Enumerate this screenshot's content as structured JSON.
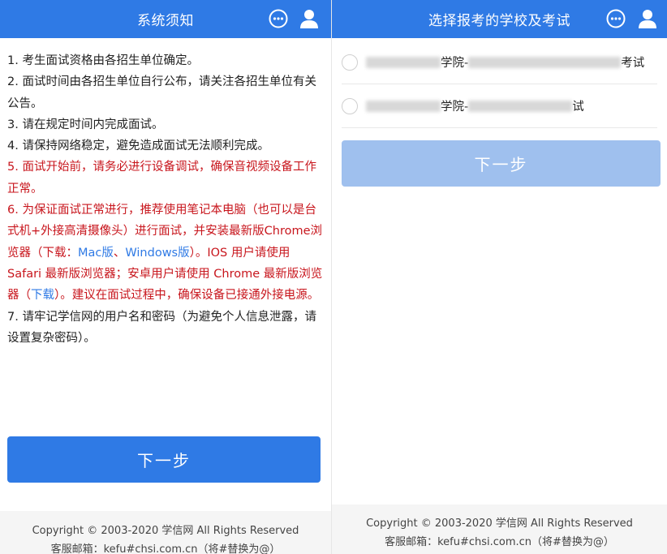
{
  "left": {
    "header_title": "系统须知",
    "notice": [
      {
        "parts": [
          {
            "text": "1. 考生面试资格由各招生单位确定。",
            "style": "normal"
          }
        ]
      },
      {
        "parts": [
          {
            "text": "2. 面试时间由各招生单位自行公布，请关注各招生单位有关公告。",
            "style": "normal"
          }
        ]
      },
      {
        "parts": [
          {
            "text": "3. 请在规定时间内完成面试。",
            "style": "normal"
          }
        ]
      },
      {
        "parts": [
          {
            "text": "4. 请保持网络稳定，避免造成面试无法顺利完成。",
            "style": "normal"
          }
        ]
      },
      {
        "parts": [
          {
            "text": "5. 面试开始前，请务必进行设备调试，确保音视频设备工作正常。",
            "style": "red"
          }
        ]
      },
      {
        "parts": [
          {
            "text": "6. 为保证面试正常进行，推荐使用笔记本电脑（也可以是台式机+外接高清摄像头）进行面试，并安装最新版Chrome浏览器（下载：",
            "style": "red"
          },
          {
            "text": "Mac版",
            "style": "blue"
          },
          {
            "text": "、",
            "style": "red"
          },
          {
            "text": "Windows版",
            "style": "blue"
          },
          {
            "text": "）。IOS 用户请使用 Safari 最新版浏览器；安卓用户请使用 Chrome 最新版浏览器（",
            "style": "red"
          },
          {
            "text": "下载",
            "style": "blue"
          },
          {
            "text": "）。建议在面试过程中，确保设备已接通外接电源。",
            "style": "red"
          }
        ]
      },
      {
        "parts": [
          {
            "text": "7. 请牢记学信网的用户名和密码（为避免个人信息泄露，请设置复杂密码）。",
            "style": "normal"
          }
        ]
      }
    ],
    "next_label": "下一步",
    "footer": {
      "copyright": "Copyright © 2003-2020 学信网 All Rights Reserved",
      "contact": "客服邮箱：kefu#chsi.com.cn（将#替换为@）"
    }
  },
  "right": {
    "header_title": "选择报考的学校及考试",
    "schools": [
      {
        "visible_mid": "学院-",
        "visible_end": "考试"
      },
      {
        "visible_mid": "学院-",
        "visible_end": "试"
      }
    ],
    "next_label": "下一步",
    "footer": {
      "copyright": "Copyright © 2003-2020 学信网 All Rights Reserved",
      "contact": "客服邮箱：kefu#chsi.com.cn（将#替换为@）"
    }
  },
  "icons": {
    "chat": "chat-bubble-icon",
    "user": "user-icon"
  },
  "colors": {
    "primary": "#2f7ae5",
    "primary_disabled": "#9fc0ee",
    "warning": "#c8161d",
    "footer_bg": "#f5f5f5"
  }
}
